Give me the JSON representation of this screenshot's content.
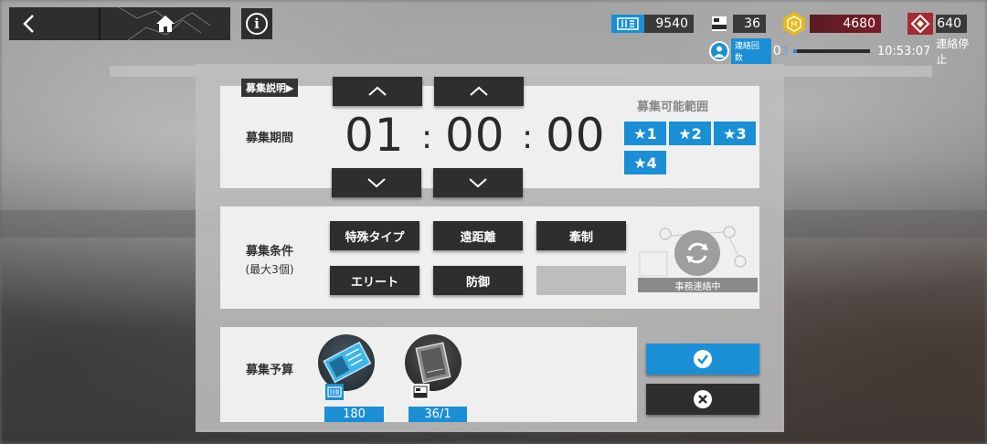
{
  "top": {
    "resources": {
      "originite": {
        "icon": "originite-prime-icon",
        "value": "9540"
      },
      "recruit_permit": {
        "icon": "recruitment-permit-icon",
        "value": "36"
      },
      "lmd": {
        "icon": "lmd-coin-icon",
        "value": "4680"
      },
      "orundum": {
        "icon": "orundum-icon",
        "value": "640"
      }
    },
    "contact": {
      "label": "連絡回数",
      "count": "0",
      "count_max": "3",
      "time": "10:53:07",
      "stop_label": "連絡停止",
      "progress": 0.05
    }
  },
  "recruit": {
    "explain_label": "募集説明▶",
    "time_label": "募集期間",
    "hours": "01",
    "minutes": "00",
    "seconds": "00",
    "separator": ":",
    "range_title": "募集可能範囲",
    "stars": [
      "★1",
      "★2",
      "★3",
      "★4"
    ],
    "tags_label_line1": "募集条件",
    "tags_label_line2": "(最大3個)",
    "tags": [
      "特殊タイプ",
      "遠距離",
      "牽制",
      "エリート",
      "防御",
      ""
    ],
    "hr_status": "事務連絡中",
    "budget_label": "募集予算",
    "permit_qty": "180",
    "plan_qty": "36/1"
  },
  "colors": {
    "accent": "#1b8fd6",
    "dark_button": "#2e2e2e",
    "lmd_bar": "#7a1c26"
  }
}
